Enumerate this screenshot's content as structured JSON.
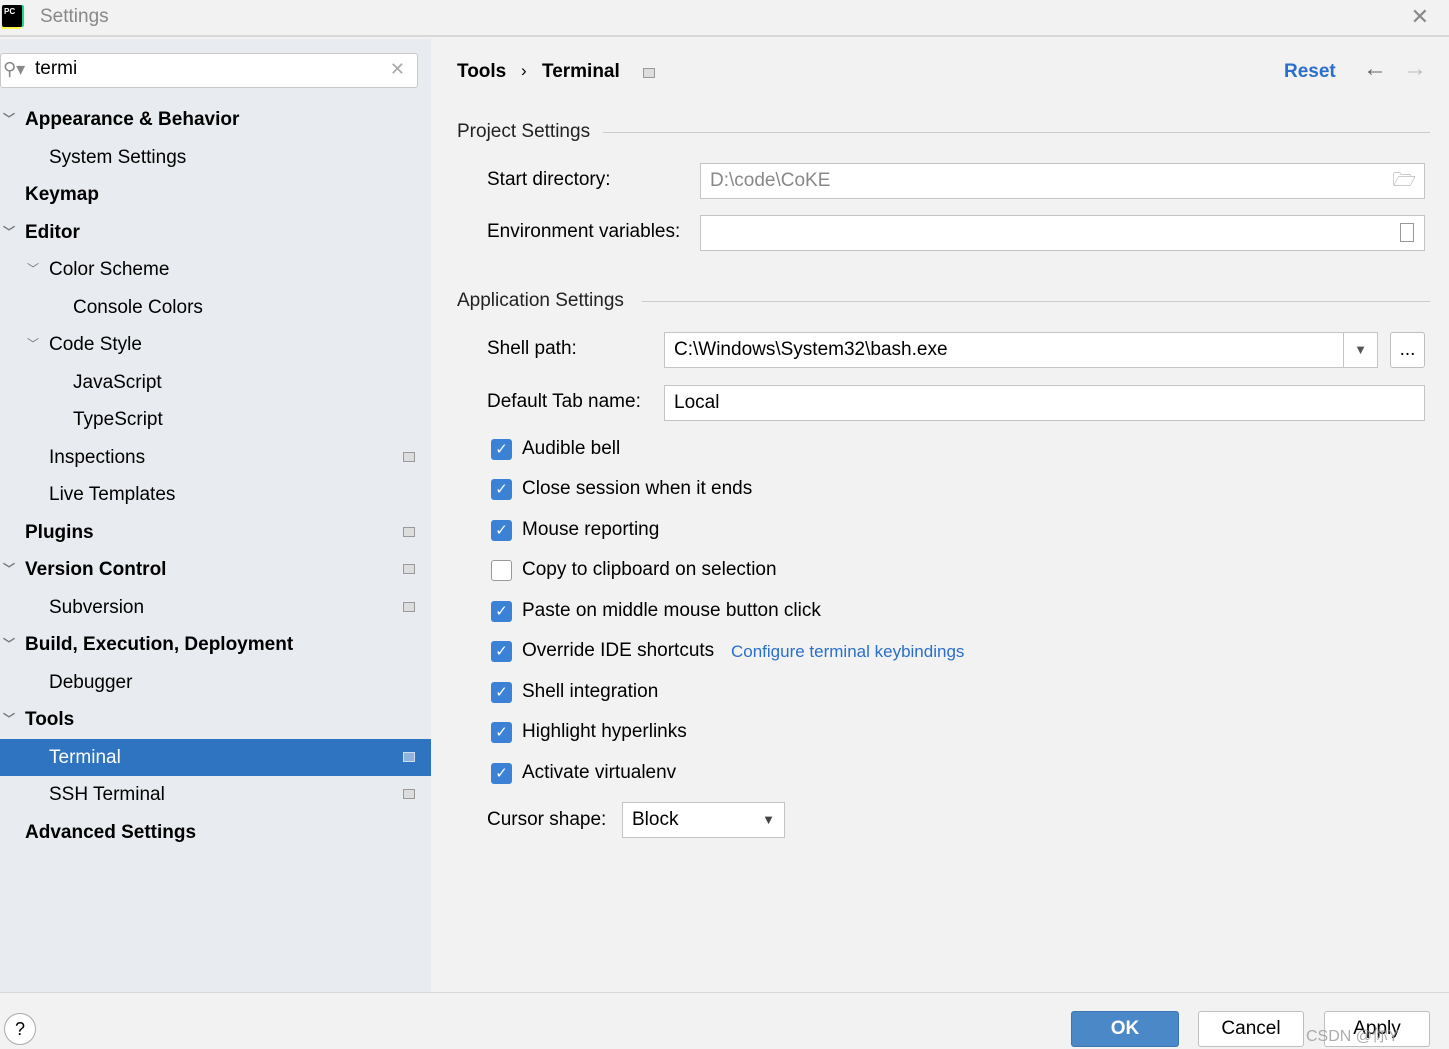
{
  "window": {
    "title": "Settings",
    "logo_text": "PC"
  },
  "search": {
    "value": "termi"
  },
  "sidebar": {
    "items": [
      {
        "label": "Appearance & Behavior",
        "bold": true,
        "level": 0,
        "expanded": true,
        "cfg": false
      },
      {
        "label": "System Settings",
        "bold": false,
        "level": 1,
        "cfg": false
      },
      {
        "label": "Keymap",
        "bold": true,
        "level": 0,
        "cfg": false
      },
      {
        "label": "Editor",
        "bold": true,
        "level": 0,
        "expanded": true,
        "cfg": false
      },
      {
        "label": "Color Scheme",
        "bold": false,
        "level": 1,
        "expanded": true,
        "cfg": false
      },
      {
        "label": "Console Colors",
        "bold": false,
        "level": 2,
        "cfg": false
      },
      {
        "label": "Code Style",
        "bold": false,
        "level": 1,
        "expanded": true,
        "cfg": false
      },
      {
        "label": "JavaScript",
        "bold": false,
        "level": 2,
        "cfg": false
      },
      {
        "label": "TypeScript",
        "bold": false,
        "level": 2,
        "cfg": false
      },
      {
        "label": "Inspections",
        "bold": false,
        "level": 1,
        "cfg": true
      },
      {
        "label": "Live Templates",
        "bold": false,
        "level": 1,
        "cfg": false
      },
      {
        "label": "Plugins",
        "bold": true,
        "level": 0,
        "cfg": true
      },
      {
        "label": "Version Control",
        "bold": true,
        "level": 0,
        "expanded": true,
        "cfg": true
      },
      {
        "label": "Subversion",
        "bold": false,
        "level": 1,
        "cfg": true
      },
      {
        "label": "Build, Execution, Deployment",
        "bold": true,
        "level": 0,
        "expanded": true,
        "cfg": false
      },
      {
        "label": "Debugger",
        "bold": false,
        "level": 1,
        "cfg": false
      },
      {
        "label": "Tools",
        "bold": true,
        "level": 0,
        "expanded": true,
        "cfg": false
      },
      {
        "label": "Terminal",
        "bold": false,
        "level": 1,
        "cfg": true,
        "selected": true
      },
      {
        "label": "SSH Terminal",
        "bold": false,
        "level": 1,
        "cfg": true
      },
      {
        "label": "Advanced Settings",
        "bold": true,
        "level": 0,
        "cfg": false
      }
    ]
  },
  "header": {
    "crumb1": "Tools",
    "sep": "›",
    "crumb2": "Terminal",
    "reset": "Reset"
  },
  "project": {
    "title": "Project Settings",
    "start_dir_label": "Start directory:",
    "start_dir_value": "D:\\code\\CoKE",
    "env_label": "Environment variables:",
    "env_value": ""
  },
  "app": {
    "title": "Application Settings",
    "shell_label": "Shell path:",
    "shell_value": "C:\\Windows\\System32\\bash.exe",
    "browse": "...",
    "tab_label": "Default Tab name:",
    "tab_value": "Local",
    "checkboxes": [
      {
        "label": "Audible bell",
        "checked": true
      },
      {
        "label": "Close session when it ends",
        "checked": true
      },
      {
        "label": "Mouse reporting",
        "checked": true
      },
      {
        "label": "Copy to clipboard on selection",
        "checked": false
      },
      {
        "label": "Paste on middle mouse button click",
        "checked": true
      },
      {
        "label": "Override IDE shortcuts",
        "checked": true
      },
      {
        "label": "Shell integration",
        "checked": true
      },
      {
        "label": "Highlight hyperlinks",
        "checked": true
      },
      {
        "label": "Activate virtualenv",
        "checked": true
      }
    ],
    "keybindings_link": "Configure terminal keybindings",
    "cursor_label": "Cursor shape:",
    "cursor_value": "Block"
  },
  "footer": {
    "help": "?",
    "ok": "OK",
    "cancel": "Cancel",
    "apply": "Apply",
    "watermark": "CSDN @你Y"
  },
  "colors": {
    "accent": "#2f74c0",
    "link": "#2a6fc9",
    "sidebar_bg": "#e8ebef"
  }
}
